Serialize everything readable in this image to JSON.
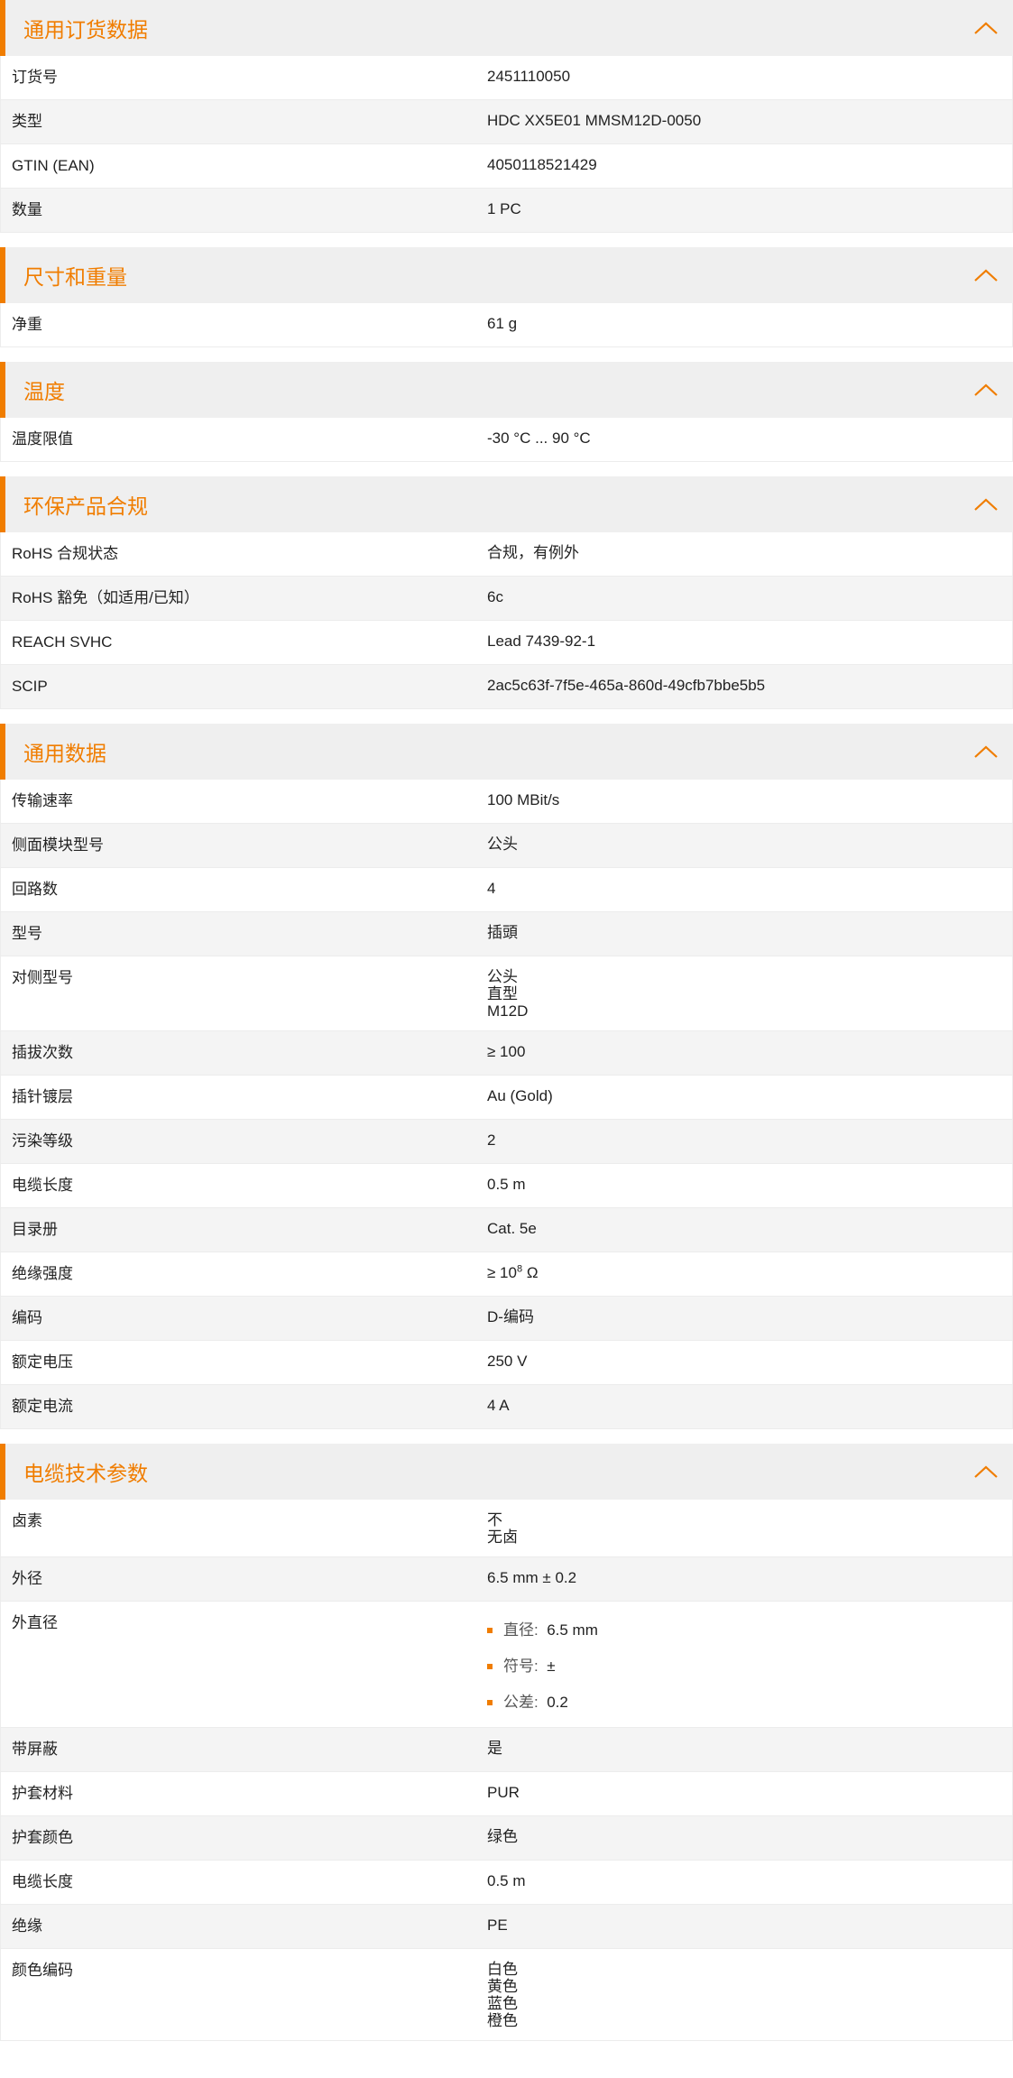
{
  "theme": {
    "accent": "#f07d00",
    "header_bg": "#efefef",
    "row_alt_bg": "#f4f4f4"
  },
  "sections": [
    {
      "title": "通用订货数据",
      "icon": "chevron-up-icon",
      "rows": [
        {
          "label": "订货号",
          "value": "2451110050"
        },
        {
          "label": "类型",
          "value": "HDC XX5E01 MMSM12D-0050"
        },
        {
          "label": "GTIN (EAN)",
          "value": "4050118521429"
        },
        {
          "label": "数量",
          "value": "1  PC"
        }
      ]
    },
    {
      "title": "尺寸和重量",
      "icon": "chevron-up-icon",
      "rows": [
        {
          "label": "净重",
          "value": "61  g"
        }
      ]
    },
    {
      "title": "温度",
      "icon": "chevron-up-icon",
      "rows": [
        {
          "label": "温度限值",
          "value": "-30 °C ... 90 °C"
        }
      ]
    },
    {
      "title": "环保产品合规",
      "icon": "chevron-up-icon",
      "rows": [
        {
          "label": "RoHS 合规状态",
          "value": "合规，有例外"
        },
        {
          "label": "RoHS 豁免（如适用/已知）",
          "value": "6c"
        },
        {
          "label": "REACH SVHC",
          "value": "Lead 7439-92-1"
        },
        {
          "label": "SCIP",
          "value": "2ac5c63f-7f5e-465a-860d-49cfb7bbe5b5"
        }
      ]
    },
    {
      "title": "通用数据",
      "icon": "chevron-up-icon",
      "rows": [
        {
          "label": "传输速率",
          "value": "100 MBit/s"
        },
        {
          "label": "侧面模块型号",
          "value": "公头"
        },
        {
          "label": "回路数",
          "value": "4"
        },
        {
          "label": "型号",
          "value": "插頭"
        },
        {
          "label": "对侧型号",
          "lines": [
            "公头",
            "直型",
            "M12D"
          ]
        },
        {
          "label": "插拔次数",
          "value": "≥ 100"
        },
        {
          "label": "插针镀层",
          "value": "Au (Gold)"
        },
        {
          "label": "污染等级",
          "value": "2"
        },
        {
          "label": "电缆长度",
          "value": "0.5  m"
        },
        {
          "label": "目录册",
          "value": "Cat. 5e"
        },
        {
          "label": "绝缘强度",
          "value_prefix": "≥ 10",
          "value_sup": "8",
          "value_suffix": " Ω"
        },
        {
          "label": "编码",
          "value": "D-编码"
        },
        {
          "label": "额定电压",
          "value": "250  V"
        },
        {
          "label": "额定电流",
          "value": "4  A"
        }
      ]
    },
    {
      "title": "电缆技术参数",
      "icon": "chevron-up-icon",
      "rows": [
        {
          "label": "卤素",
          "lines": [
            "不",
            "无卤"
          ]
        },
        {
          "label": "外径",
          "value": "6.5 mm ± 0.2"
        },
        {
          "label": "外直径",
          "bullets": [
            {
              "key": "直径:",
              "val": "6.5 mm"
            },
            {
              "key": "符号:",
              "val": "±"
            },
            {
              "key": "公差:",
              "val": "0.2"
            }
          ]
        },
        {
          "label": "带屏蔽",
          "value": "是"
        },
        {
          "label": "护套材料",
          "value": "PUR"
        },
        {
          "label": "护套颜色",
          "value": "绿色"
        },
        {
          "label": "电缆长度",
          "value": "0.5  m"
        },
        {
          "label": "绝缘",
          "value": "PE"
        },
        {
          "label": "颜色编码",
          "lines": [
            "白色",
            "黄色",
            "蓝色",
            "橙色"
          ]
        }
      ]
    }
  ]
}
